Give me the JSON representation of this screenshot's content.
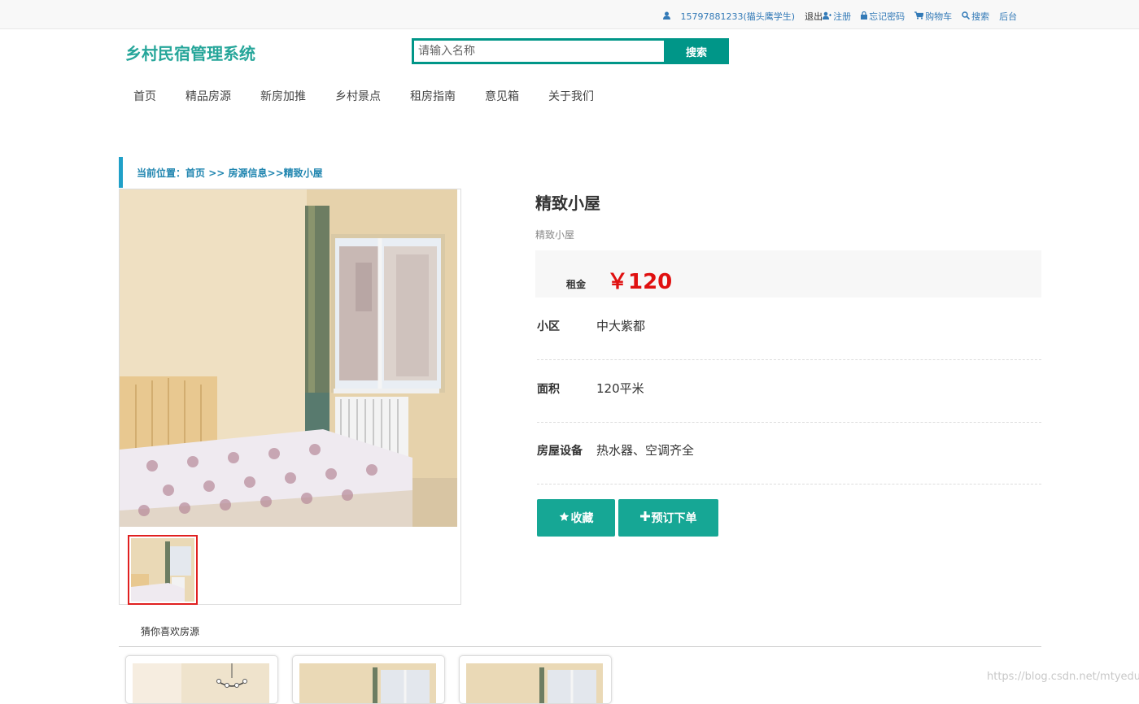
{
  "topbar": {
    "user": "15797881233(猫头鹰学生)",
    "logout": "退出",
    "register": "注册",
    "forgot": "忘记密码",
    "cart": "购物车",
    "search": "搜索",
    "admin": "后台"
  },
  "header": {
    "logo": "乡村民宿管理系统",
    "search_placeholder": "请输入名称",
    "search_button": "搜索"
  },
  "nav": {
    "items": [
      "首页",
      "精品房源",
      "新房加推",
      "乡村景点",
      "租房指南",
      "意见箱",
      "关于我们"
    ]
  },
  "breadcrumb": {
    "prefix": "当前位置：",
    "home": "首页",
    "sep": " >> ",
    "category": "房源信息",
    "current": ">>精致小屋"
  },
  "detail": {
    "title": "精致小屋",
    "subtitle": "精致小屋",
    "price_label": "租金",
    "price_value": "￥120",
    "rows": [
      {
        "key": "小区",
        "value": "中大紫都"
      },
      {
        "key": "面积",
        "value": "120平米"
      },
      {
        "key": "房屋设备",
        "value": "热水器、空调齐全"
      }
    ],
    "favorite_button": "收藏",
    "order_button": "预订下单"
  },
  "recommend": {
    "title": "猜你喜欢房源"
  },
  "watermark": "https://blog.csdn.net/mtyedu",
  "colors": {
    "accent": "#009688",
    "button": "#16a795",
    "price": "#e01010",
    "link": "#337ab7"
  }
}
